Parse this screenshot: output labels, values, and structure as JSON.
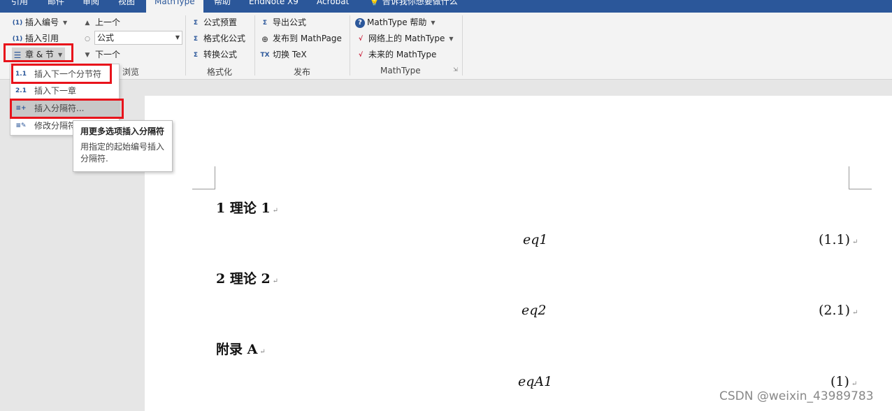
{
  "ribbon_tabs": [
    "引用",
    "邮件",
    "审阅",
    "视图",
    "MathType",
    "帮助",
    "EndNote X9",
    "Acrobat",
    "告诉我你想要做什么"
  ],
  "active_tab_index": 4,
  "groups": {
    "insert": {
      "insert_number": "插入编号",
      "insert_reference": "插入引用",
      "chapter_section": "章 & 节"
    },
    "browse": {
      "label": "浏览",
      "previous": "上一个",
      "combo_value": "公式",
      "next": "下一个"
    },
    "format": {
      "label": "格式化",
      "equation_presets": "公式预置",
      "format_equations": "格式化公式",
      "convert_equations": "转换公式"
    },
    "publish": {
      "label": "发布",
      "export_equations": "导出公式",
      "publish_mathpage": "发布到 MathPage",
      "toggle_tex": "切换 TeX"
    },
    "mathtype": {
      "label": "MathType",
      "help": "MathType 帮助",
      "online": "网络上的 MathType",
      "future": "未来的 MathType"
    }
  },
  "menu_items": [
    "插入下一个分节符",
    "插入下一章",
    "插入分隔符...",
    "修改分隔符"
  ],
  "tooltip": {
    "title": "用更多选项插入分隔符",
    "body": "用指定的起始编号插入分隔符."
  },
  "document": {
    "heading1": "1  理论 1",
    "eq1": "eq1",
    "eq1_num": "(1.1)",
    "heading2": "2  理论 2",
    "eq2": "eq2",
    "eq2_num": "(2.1)",
    "heading3": "附录 A",
    "eq3": "eqA1",
    "eq3_num": "(1)",
    "paragraph_mark": "↵"
  },
  "watermark": "CSDN @weixin_43989783",
  "colors": {
    "ribbon_blue": "#2b579a",
    "highlight_red": "#e8131b"
  }
}
